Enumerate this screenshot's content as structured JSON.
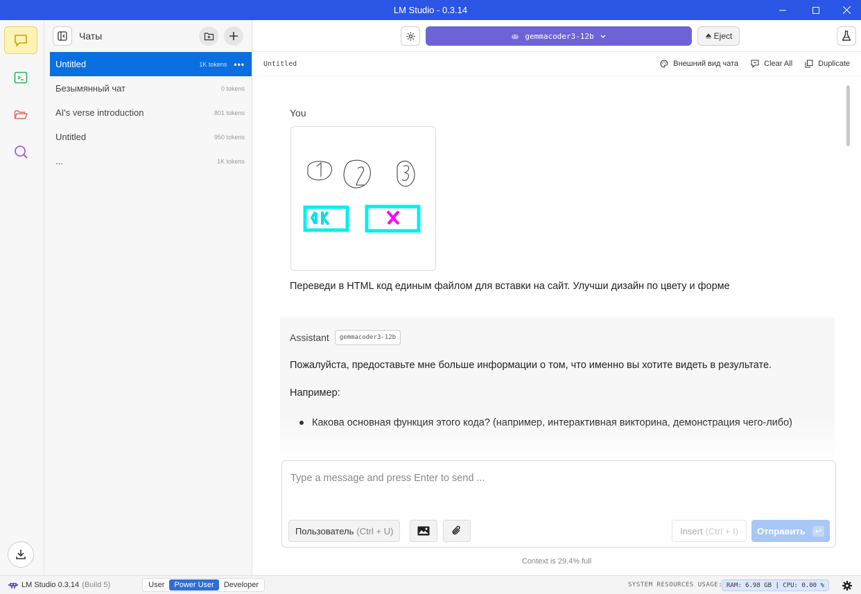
{
  "window": {
    "title": "LM Studio - 0.3.14"
  },
  "sidebar": {
    "title": "Чаты"
  },
  "chats": [
    {
      "name": "Untitled",
      "tokens": "1K tokens",
      "selected": true
    },
    {
      "name": "Безымянный чат",
      "tokens": "0 tokens"
    },
    {
      "name": "AI's verse introduction",
      "tokens": "801 tokens"
    },
    {
      "name": "Untitled",
      "tokens": "950 tokens"
    },
    {
      "name": "...",
      "tokens": "1K tokens"
    }
  ],
  "topbar": {
    "model": "gemmacoder3-12b",
    "eject": "Eject"
  },
  "subbar": {
    "chat_name": "Untitled",
    "appearance": "Внешний вид чата",
    "clear_all": "Clear All",
    "duplicate": "Duplicate"
  },
  "conversation": {
    "user_label": "You",
    "user_text": "Переведи в HTML код единым файлом для вставки на сайт. Улучши дизайн по цвету и форме",
    "assistant_label": "Assistant",
    "assistant_model": "gemmacoder3-12b",
    "assistant_p1": "Пожалуйста, предоставьте мне больше информации о том, что именно вы хотите видеть в результате.",
    "assistant_p2": "Например:",
    "assistant_li1": "Какова основная функция этого кода? (например, интерактивная викторина, демонстрация чего-либо)"
  },
  "input": {
    "placeholder": "Type a message and press Enter to send ...",
    "role_label": "Пользователь",
    "role_shortcut": "(Ctrl + U)",
    "insert_label": "Insert",
    "insert_shortcut": "(Ctrl + I)",
    "send_label": "Отправить",
    "send_key": "↩"
  },
  "context": "Context is 29.4% full",
  "status": {
    "app": "LM Studio 0.3.14",
    "build": "(Build 5)",
    "modes": [
      "User",
      "Power User",
      "Developer"
    ],
    "active_mode": "Power User",
    "resources_label": "SYSTEM RESOURCES USAGE:",
    "resources": "RAM: 6.98 GB  |  CPU: 0.00 %"
  },
  "colors": {
    "titlebar": "#2b56e5",
    "accent": "#0a6fe0",
    "model": "#6e63d6"
  }
}
